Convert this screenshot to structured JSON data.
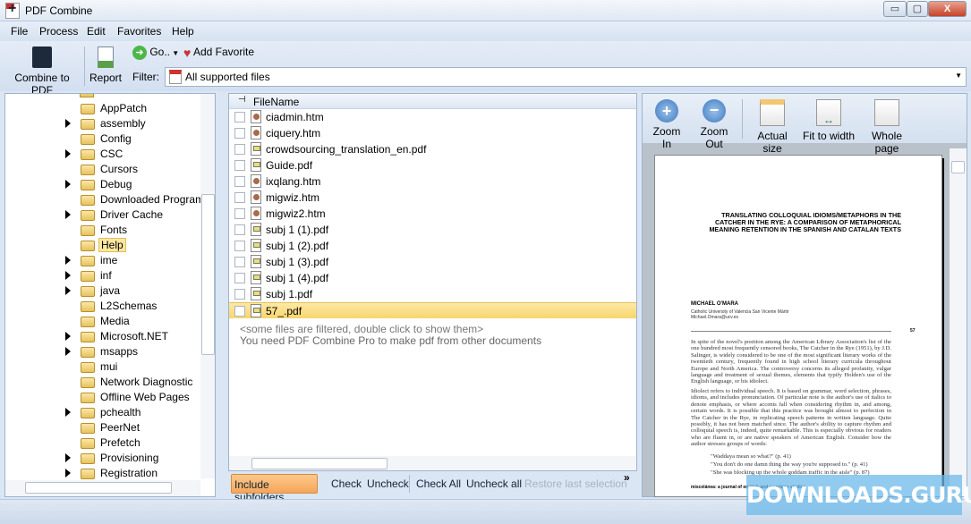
{
  "window": {
    "title": "PDF Combine",
    "minimize": "▭",
    "maximize": "▢",
    "close": "X"
  },
  "menu": [
    "File",
    "Process",
    "Edit",
    "Favorites",
    "Help"
  ],
  "toolbar": {
    "combine": "Combine to PDF",
    "report": "Report",
    "go": "Go..",
    "add_favorite": "Add Favorite",
    "filter_label": "Filter:",
    "filter_value": "All supported files"
  },
  "tree": [
    {
      "name": "AppPatch",
      "expandable": false
    },
    {
      "name": "assembly",
      "expandable": true
    },
    {
      "name": "Config",
      "expandable": false
    },
    {
      "name": "CSC",
      "expandable": true
    },
    {
      "name": "Cursors",
      "expandable": false
    },
    {
      "name": "Debug",
      "expandable": true
    },
    {
      "name": "Downloaded Program Fil",
      "expandable": false
    },
    {
      "name": "Driver Cache",
      "expandable": true
    },
    {
      "name": "Fonts",
      "expandable": false
    },
    {
      "name": "Help",
      "expandable": false,
      "selected": true
    },
    {
      "name": "ime",
      "expandable": true
    },
    {
      "name": "inf",
      "expandable": true
    },
    {
      "name": "java",
      "expandable": true
    },
    {
      "name": "L2Schemas",
      "expandable": false
    },
    {
      "name": "Media",
      "expandable": false
    },
    {
      "name": "Microsoft.NET",
      "expandable": true
    },
    {
      "name": "msapps",
      "expandable": true
    },
    {
      "name": "mui",
      "expandable": false
    },
    {
      "name": "Network Diagnostic",
      "expandable": false
    },
    {
      "name": "Offline Web Pages",
      "expandable": false
    },
    {
      "name": "pchealth",
      "expandable": true
    },
    {
      "name": "PeerNet",
      "expandable": false
    },
    {
      "name": "Prefetch",
      "expandable": false
    },
    {
      "name": "Provisioning",
      "expandable": true
    },
    {
      "name": "Registration",
      "expandable": true
    }
  ],
  "files": {
    "header": "FileName",
    "rows": [
      {
        "name": "ciadmin.htm",
        "type": "htm"
      },
      {
        "name": "ciquery.htm",
        "type": "htm"
      },
      {
        "name": "crowdsourcing_translation_en.pdf",
        "type": "pdf"
      },
      {
        "name": "Guide.pdf",
        "type": "pdf"
      },
      {
        "name": "ixqlang.htm",
        "type": "htm"
      },
      {
        "name": "migwiz.htm",
        "type": "htm"
      },
      {
        "name": "migwiz2.htm",
        "type": "htm"
      },
      {
        "name": "subj 1 (1).pdf",
        "type": "pdf"
      },
      {
        "name": "subj 1 (2).pdf",
        "type": "pdf"
      },
      {
        "name": "subj 1 (3).pdf",
        "type": "pdf"
      },
      {
        "name": "subj 1 (4).pdf",
        "type": "pdf"
      },
      {
        "name": "subj 1.pdf",
        "type": "pdf"
      },
      {
        "name": "57_.pdf",
        "type": "pdf",
        "selected": true
      }
    ],
    "note1": "<some files are filtered, double click to show them>",
    "note2": "You need PDF Combine Pro to make pdf from other documents"
  },
  "bottom": {
    "include": "Include subfolders",
    "check": "Check",
    "uncheck": "Uncheck",
    "check_all": "Check All",
    "uncheck_all": "Uncheck all",
    "restore": "Restore last selection",
    "more": "»"
  },
  "viewer": {
    "zoom_in": "Zoom In",
    "zoom_out": "Zoom Out",
    "actual": "Actual size",
    "fit_width": "Fit to width",
    "whole": "Whole page"
  },
  "document": {
    "title": "TRANSLATING COLLOQUIAL IDIOMS/METAPHORS IN THE CATCHER IN THE RYE: A COMPARISON OF METAPHORICAL MEANING RETENTION IN THE SPANISH AND CATALAN TEXTS",
    "author": "MICHAEL O'MARA",
    "affiliation": "Catholic University of Valencia San Vicente Mártir",
    "email": "Michael.Omara@ucv.es",
    "page": "57",
    "para1": "In spite of the novel's position among the American Library Association's list of the one hundred most frequently censored books, The Catcher in the Rye (1951), by J.D. Salinger, is widely considered to be one of the most significant literary works of the twentieth century, frequently found in high school literary curricula throughout Europe and North America. The controversy concerns its alleged profanity, vulgar language and treatment of sexual themes, elements that typify Holden's use of the English language, or his idiolect.",
    "para2": "Idiolect refers to individual speech. It is based on grammar, word selection, phrases, idioms, and includes pronunciation. Of particular note is the author's use of italics to denote emphasis, or where accents fall when considering rhythm in, and among, certain words. It is possible that this practice was brought almost to perfection in The Catcher in the Rye, in replicating speech patterns in written language. Quite possibly, it has not been matched since. The author's ability to capture rhythm and colloquial speech is, indeed, quite remarkable. This is especially obvious for readers who are fluent in, or are native speakers of American English. Consider how the author stresses groups of words:",
    "quotes": [
      "\"Waddaya mean so what?\" (p. 41)",
      "\"You don't do one damn thing the way you're supposed to.\" (p. 41)",
      "\"She was blocking up the whole goddam traffic in the aisle\" (p. 87)"
    ],
    "footer": "miscelánea: a journal of english and american studies"
  },
  "watermark": "DOWNLOADS.GURU",
  "colors": {
    "accent": "#f7b46a",
    "selection": "#fbe6a1",
    "chrome": "#dbe6f4"
  }
}
